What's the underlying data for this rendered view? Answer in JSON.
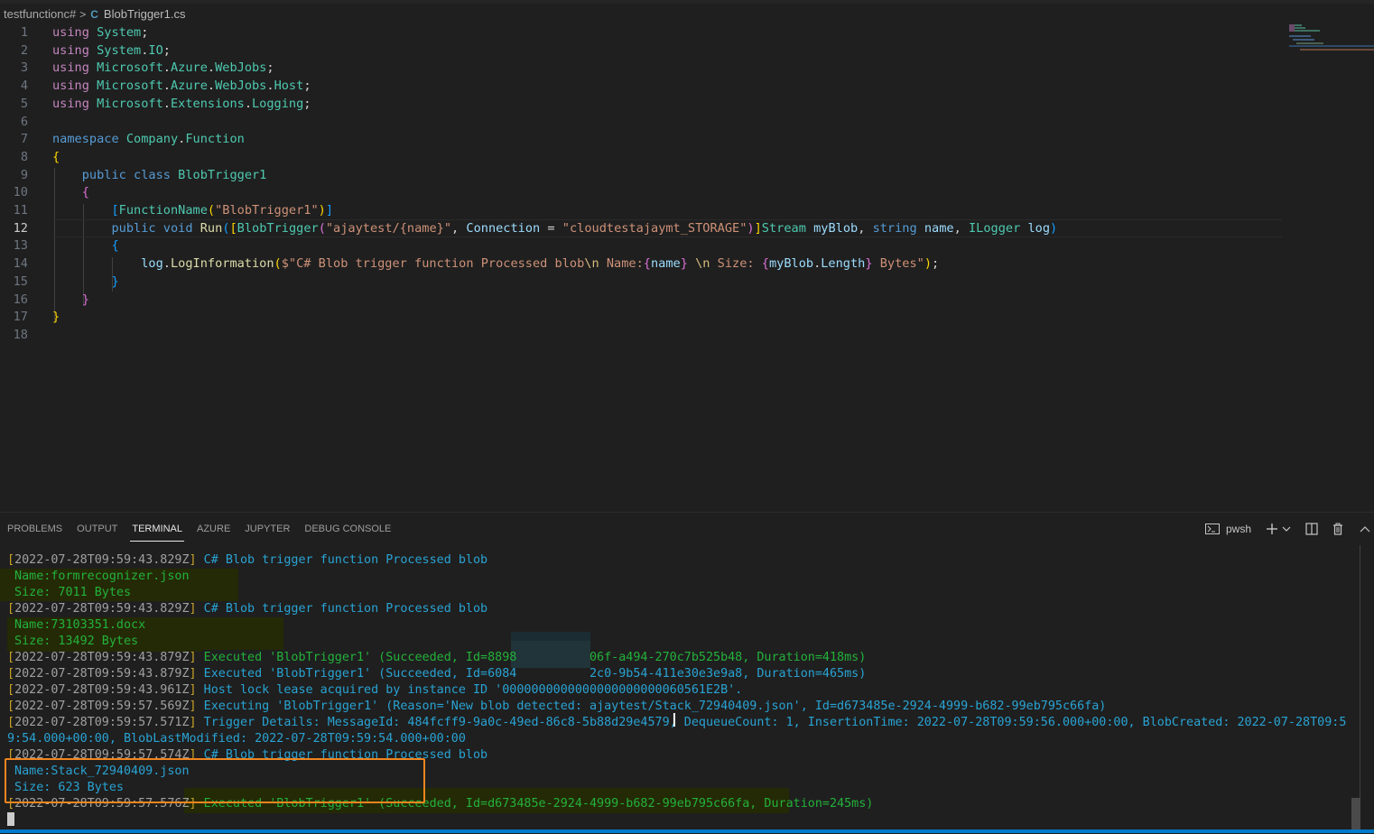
{
  "breadcrumb": {
    "folder": "testfunctionc#",
    "separator": ">",
    "file_icon": "C#",
    "file": "BlobTrigger1.cs"
  },
  "editor": {
    "current_line": 12,
    "lines": [
      {
        "n": "1",
        "tokens": [
          [
            "kw",
            "using"
          ],
          [
            "p",
            " "
          ],
          [
            "ty",
            "System"
          ],
          [
            "p",
            ";"
          ]
        ]
      },
      {
        "n": "2",
        "tokens": [
          [
            "kw",
            "using"
          ],
          [
            "p",
            " "
          ],
          [
            "ty",
            "System"
          ],
          [
            "p",
            "."
          ],
          [
            "ty",
            "IO"
          ],
          [
            "p",
            ";"
          ]
        ]
      },
      {
        "n": "3",
        "tokens": [
          [
            "kw",
            "using"
          ],
          [
            "p",
            " "
          ],
          [
            "ty",
            "Microsoft"
          ],
          [
            "p",
            "."
          ],
          [
            "ty",
            "Azure"
          ],
          [
            "p",
            "."
          ],
          [
            "ty",
            "WebJobs"
          ],
          [
            "p",
            ";"
          ]
        ]
      },
      {
        "n": "4",
        "tokens": [
          [
            "kw",
            "using"
          ],
          [
            "p",
            " "
          ],
          [
            "ty",
            "Microsoft"
          ],
          [
            "p",
            "."
          ],
          [
            "ty",
            "Azure"
          ],
          [
            "p",
            "."
          ],
          [
            "ty",
            "WebJobs"
          ],
          [
            "p",
            "."
          ],
          [
            "ty",
            "Host"
          ],
          [
            "p",
            ";"
          ]
        ]
      },
      {
        "n": "5",
        "tokens": [
          [
            "kw",
            "using"
          ],
          [
            "p",
            " "
          ],
          [
            "ty",
            "Microsoft"
          ],
          [
            "p",
            "."
          ],
          [
            "ty",
            "Extensions"
          ],
          [
            "p",
            "."
          ],
          [
            "ty",
            "Logging"
          ],
          [
            "p",
            ";"
          ]
        ]
      },
      {
        "n": "6",
        "tokens": []
      },
      {
        "n": "7",
        "tokens": [
          [
            "kwb",
            "namespace"
          ],
          [
            "p",
            " "
          ],
          [
            "ty",
            "Company"
          ],
          [
            "p",
            "."
          ],
          [
            "ty",
            "Function"
          ]
        ]
      },
      {
        "n": "8",
        "tokens": [
          [
            "b1",
            "{"
          ]
        ]
      },
      {
        "n": "9",
        "tokens": [
          [
            "p",
            "    "
          ],
          [
            "kwb",
            "public"
          ],
          [
            "p",
            " "
          ],
          [
            "kwb",
            "class"
          ],
          [
            "p",
            " "
          ],
          [
            "ty",
            "BlobTrigger1"
          ]
        ]
      },
      {
        "n": "10",
        "tokens": [
          [
            "p",
            "    "
          ],
          [
            "b2",
            "{"
          ]
        ]
      },
      {
        "n": "11",
        "tokens": [
          [
            "p",
            "        "
          ],
          [
            "b3",
            "["
          ],
          [
            "ty",
            "FunctionName"
          ],
          [
            "b1",
            "("
          ],
          [
            "str",
            "\"BlobTrigger1\""
          ],
          [
            "b1",
            ")"
          ],
          [
            "b3",
            "]"
          ]
        ]
      },
      {
        "n": "12",
        "tokens": [
          [
            "p",
            "        "
          ],
          [
            "kwb",
            "public"
          ],
          [
            "p",
            " "
          ],
          [
            "kwb",
            "void"
          ],
          [
            "p",
            " "
          ],
          [
            "fn",
            "Run"
          ],
          [
            "b3",
            "("
          ],
          [
            "b1",
            "["
          ],
          [
            "ty",
            "BlobTrigger"
          ],
          [
            "b2",
            "("
          ],
          [
            "str",
            "\"ajaytest/{name}\""
          ],
          [
            "p",
            ", "
          ],
          [
            "var",
            "Connection"
          ],
          [
            "p",
            " = "
          ],
          [
            "str",
            "\"cloudtestajaymt_STORAGE\""
          ],
          [
            "b2",
            ")"
          ],
          [
            "b1",
            "]"
          ],
          [
            "ty",
            "Stream"
          ],
          [
            "p",
            " "
          ],
          [
            "var",
            "myBlob"
          ],
          [
            "p",
            ", "
          ],
          [
            "kwb",
            "string"
          ],
          [
            "p",
            " "
          ],
          [
            "var",
            "name"
          ],
          [
            "p",
            ", "
          ],
          [
            "ty",
            "ILogger"
          ],
          [
            "p",
            " "
          ],
          [
            "var",
            "log"
          ],
          [
            "b3",
            ")"
          ]
        ]
      },
      {
        "n": "13",
        "tokens": [
          [
            "p",
            "        "
          ],
          [
            "b3",
            "{"
          ]
        ]
      },
      {
        "n": "14",
        "tokens": [
          [
            "p",
            "            "
          ],
          [
            "var",
            "log"
          ],
          [
            "p",
            "."
          ],
          [
            "fn",
            "LogInformation"
          ],
          [
            "b1",
            "("
          ],
          [
            "str",
            "$\"C# Blob trigger function Processed blob"
          ],
          [
            "esc",
            "\\n"
          ],
          [
            "str",
            " Name:"
          ],
          [
            "b2",
            "{"
          ],
          [
            "var",
            "name"
          ],
          [
            "b2",
            "}"
          ],
          [
            "str",
            " "
          ],
          [
            "esc",
            "\\n"
          ],
          [
            "str",
            " Size: "
          ],
          [
            "b2",
            "{"
          ],
          [
            "var",
            "myBlob"
          ],
          [
            "p",
            "."
          ],
          [
            "var",
            "Length"
          ],
          [
            "b2",
            "}"
          ],
          [
            "str",
            " Bytes\""
          ],
          [
            "b1",
            ")"
          ],
          [
            "p",
            ";"
          ]
        ]
      },
      {
        "n": "15",
        "tokens": [
          [
            "p",
            "        "
          ],
          [
            "b3",
            "}"
          ]
        ]
      },
      {
        "n": "16",
        "tokens": [
          [
            "p",
            "    "
          ],
          [
            "b2",
            "}"
          ]
        ]
      },
      {
        "n": "17",
        "tokens": [
          [
            "b1",
            "}"
          ]
        ]
      },
      {
        "n": "18",
        "tokens": []
      }
    ]
  },
  "panel": {
    "tabs": [
      {
        "label": "PROBLEMS",
        "active": false
      },
      {
        "label": "OUTPUT",
        "active": false
      },
      {
        "label": "TERMINAL",
        "active": true
      },
      {
        "label": "AZURE",
        "active": false
      },
      {
        "label": "JUPYTER",
        "active": false
      },
      {
        "label": "DEBUG CONSOLE",
        "active": false
      }
    ],
    "terminal_shell": "pwsh",
    "toolbar_icons": [
      "terminal-icon",
      "add-terminal-icon",
      "dropdown-chevron-icon",
      "split-terminal-icon",
      "trash-icon",
      "maximize-panel-icon"
    ]
  },
  "terminal": {
    "lines": [
      {
        "ts": "2022-07-28T09:59:43.829Z",
        "cls": "tc",
        "text": "C# Blob trigger function Processed blob"
      },
      {
        "ts": "",
        "cls": "tg",
        "text": " Name:formrecognizer.json"
      },
      {
        "ts": "",
        "cls": "tg",
        "text": " Size: 7011 Bytes"
      },
      {
        "ts": "2022-07-28T09:59:43.829Z",
        "cls": "tc",
        "text": "C# Blob trigger function Processed blob"
      },
      {
        "ts": "",
        "cls": "tg",
        "text": " Name:73103351.docx"
      },
      {
        "ts": "",
        "cls": "tg",
        "text": " Size: 13492 Bytes"
      },
      {
        "ts": "2022-07-28T09:59:43.879Z",
        "cls": "tg",
        "text": "Executed 'BlobTrigger1' (Succeeded, Id=8898          06f-a494-270c7b525b48, Duration=418ms)"
      },
      {
        "ts": "2022-07-28T09:59:43.879Z",
        "cls": "tc",
        "text": "Executed 'BlobTrigger1' (Succeeded, Id=6084          2c0-9b54-411e30e3e9a8, Duration=465ms)"
      },
      {
        "ts": "2022-07-28T09:59:43.961Z",
        "cls": "tc",
        "text": "Host lock lease acquired by instance ID '0000000000000000000000060561E2B'."
      },
      {
        "ts": "2022-07-28T09:59:57.569Z",
        "cls": "tc",
        "text": "Executing 'BlobTrigger1' (Reason='New blob detected: ajaytest/Stack_72940409.json', Id=d673485e-2924-4999-b682-99eb795c66fa)"
      },
      {
        "ts": "2022-07-28T09:59:57.571Z",
        "cls": "tc",
        "text": "Trigger Details: MessageId: 484fcff9-9a0c-49ed-86c8-5b88d29e4579, DequeueCount: 1, InsertionTime: 2022-07-28T09:59:56.000+00:00, BlobCreated: 2022-07-28T09:5"
      },
      {
        "ts": "",
        "cls": "tc",
        "text": "9:54.000+00:00, BlobLastModified: 2022-07-28T09:59:54.000+00:00"
      },
      {
        "ts": "2022-07-28T09:59:57.574Z",
        "cls": "tc",
        "text": "C# Blob trigger function Processed blob"
      },
      {
        "ts": "",
        "cls": "tc",
        "text": " Name:Stack_72940409.json"
      },
      {
        "ts": "",
        "cls": "tc",
        "text": " Size: 623 Bytes"
      },
      {
        "ts": "2022-07-28T09:59:57.576Z",
        "cls": "tg",
        "text": "Executed 'BlobTrigger1' (Succeeded, Id=d673485e-2924-4999-b682-99eb795c66fa, Duration=245ms)"
      }
    ]
  },
  "colors": {
    "editor_bg": "#1f1f1f",
    "annotation_box": "#f0851e",
    "status_bar": "#007acc",
    "log_cyan": "#29a3d3",
    "log_green": "#23b23b"
  }
}
